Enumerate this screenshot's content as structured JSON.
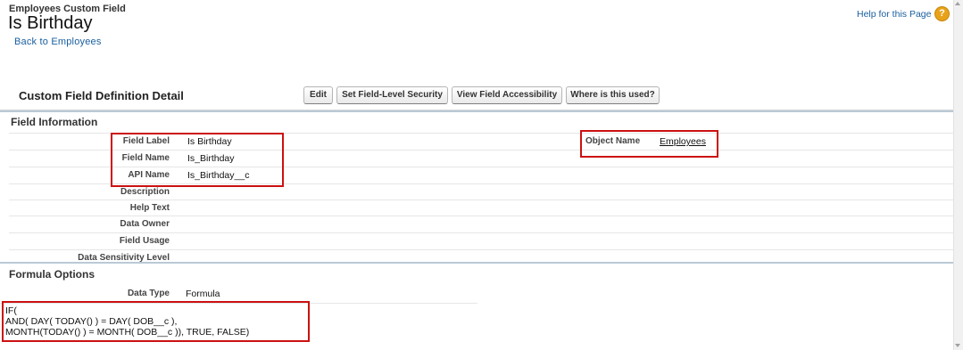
{
  "header": {
    "object_label": "Employees Custom Field",
    "title": "Is Birthday",
    "back_link": "Back to Employees",
    "help_link": "Help for this Page",
    "help_icon": "?"
  },
  "detail": {
    "title": "Custom Field Definition Detail",
    "buttons": {
      "edit": "Edit",
      "set_security": "Set Field-Level Security",
      "view_accessibility": "View Field Accessibility",
      "where_used": "Where is this used?"
    }
  },
  "field_information": {
    "title": "Field Information",
    "rows": [
      {
        "label": "Field Label",
        "value": "Is Birthday"
      },
      {
        "label": "Field Name",
        "value": "Is_Birthday"
      },
      {
        "label": "API Name",
        "value": "Is_Birthday__c"
      },
      {
        "label": "Description",
        "value": ""
      },
      {
        "label": "Help Text",
        "value": ""
      },
      {
        "label": "Data Owner",
        "value": ""
      },
      {
        "label": "Field Usage",
        "value": ""
      },
      {
        "label": "Data Sensitivity Level",
        "value": ""
      }
    ],
    "object_name_label": "Object Name",
    "object_name_value": "Employees"
  },
  "formula_options": {
    "title": "Formula Options",
    "data_type_label": "Data Type",
    "data_type_value": "Formula",
    "formula_lines": [
      "IF(",
      "AND( DAY( TODAY() ) = DAY( DOB__c ),",
      "MONTH(TODAY() ) = MONTH( DOB__c )), TRUE, FALSE)"
    ]
  },
  "colors": {
    "link": "#1a5fa0",
    "highlight_box": "#cc1111",
    "help_icon": "#e8a21a",
    "section_bar": "#b9c9d6"
  }
}
